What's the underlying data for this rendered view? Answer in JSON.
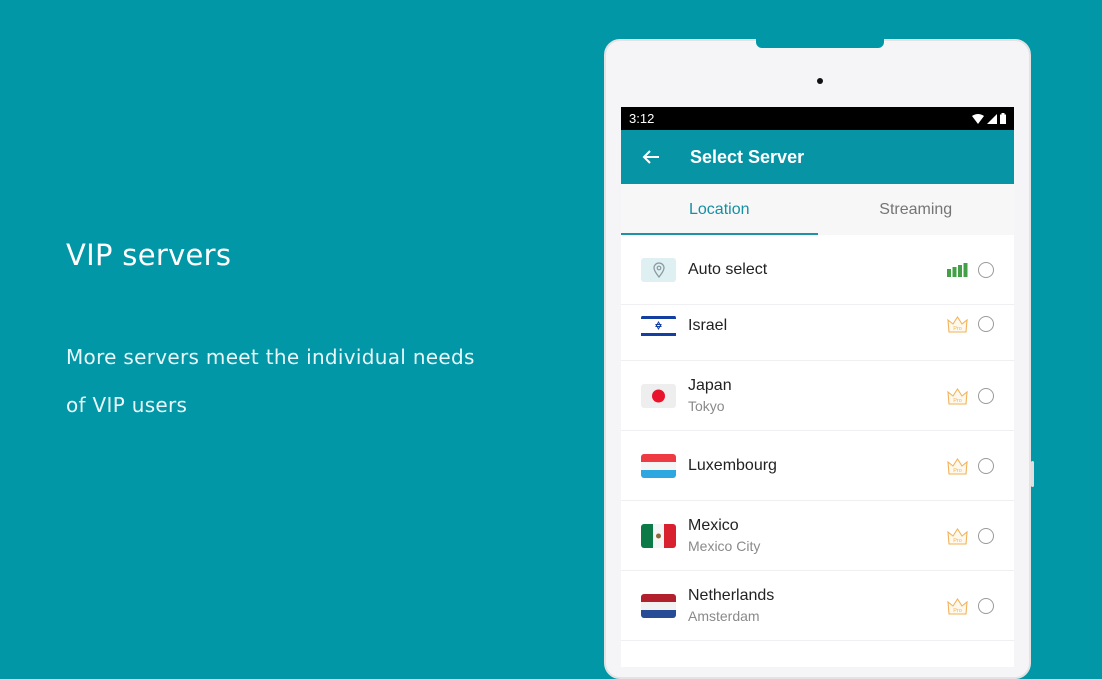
{
  "promo": {
    "title": "VIP servers",
    "description": "More servers meet the individual needs of VIP users"
  },
  "statusbar": {
    "time": "3:12",
    "icons": [
      "wifi-icon",
      "cellular-signal-icon",
      "battery-icon"
    ]
  },
  "appbar": {
    "back_icon": "arrow-left-icon",
    "title": "Select Server"
  },
  "tabs": [
    {
      "label": "Location",
      "active": true
    },
    {
      "label": "Streaming",
      "active": false
    }
  ],
  "servers": [
    {
      "name": "Auto select",
      "city": "",
      "flag": "location-pin",
      "badge": "signal-strength",
      "selected": false
    },
    {
      "name": "Israel",
      "city": "",
      "flag": "israel",
      "badge": "pro-crown",
      "selected": false
    },
    {
      "name": "Japan",
      "city": "Tokyo",
      "flag": "japan",
      "badge": "pro-crown",
      "selected": false
    },
    {
      "name": "Luxembourg",
      "city": "",
      "flag": "luxembourg",
      "badge": "pro-crown",
      "selected": false
    },
    {
      "name": "Mexico",
      "city": "Mexico City",
      "flag": "mexico",
      "badge": "pro-crown",
      "selected": false
    },
    {
      "name": "Netherlands",
      "city": "Amsterdam",
      "flag": "netherlands",
      "badge": "pro-crown",
      "selected": false
    }
  ],
  "badge_text": "Pro",
  "colors": {
    "background": "#0297a7",
    "appbar": "#0795a6",
    "accent": "#1590a3",
    "signal": "#43a047",
    "pro": "#f0b35a"
  }
}
